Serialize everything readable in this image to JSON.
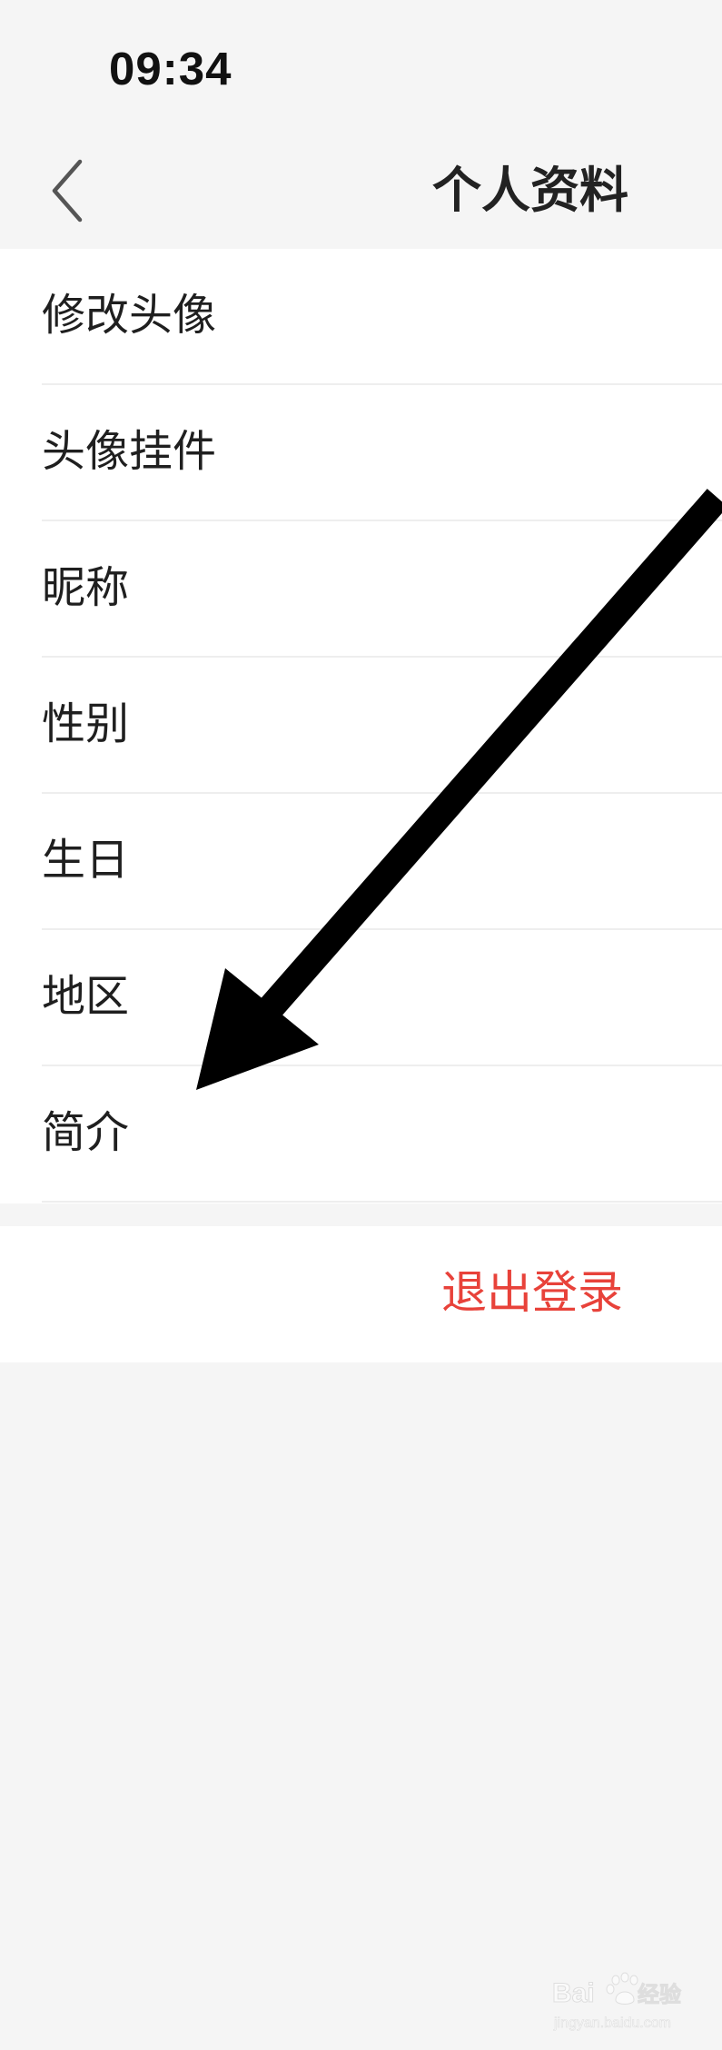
{
  "status_bar": {
    "time": "09:34"
  },
  "nav": {
    "title": "个人资料",
    "back_icon": "chevron-left-icon"
  },
  "menu": {
    "items": [
      {
        "label": "修改头像"
      },
      {
        "label": "头像挂件"
      },
      {
        "label": "昵称"
      },
      {
        "label": "性别"
      },
      {
        "label": "生日"
      },
      {
        "label": "地区"
      },
      {
        "label": "简介"
      }
    ]
  },
  "logout": {
    "label": "退出登录",
    "color": "#e8423a"
  },
  "annotation": {
    "arrow_icon": "arrow-pointer-icon"
  },
  "watermark": {
    "brand": "Bai du 经验",
    "url": "jingyan.baidu.com"
  },
  "colors": {
    "background": "#f5f5f5",
    "card": "#ffffff",
    "text": "#1f1f1f"
  }
}
